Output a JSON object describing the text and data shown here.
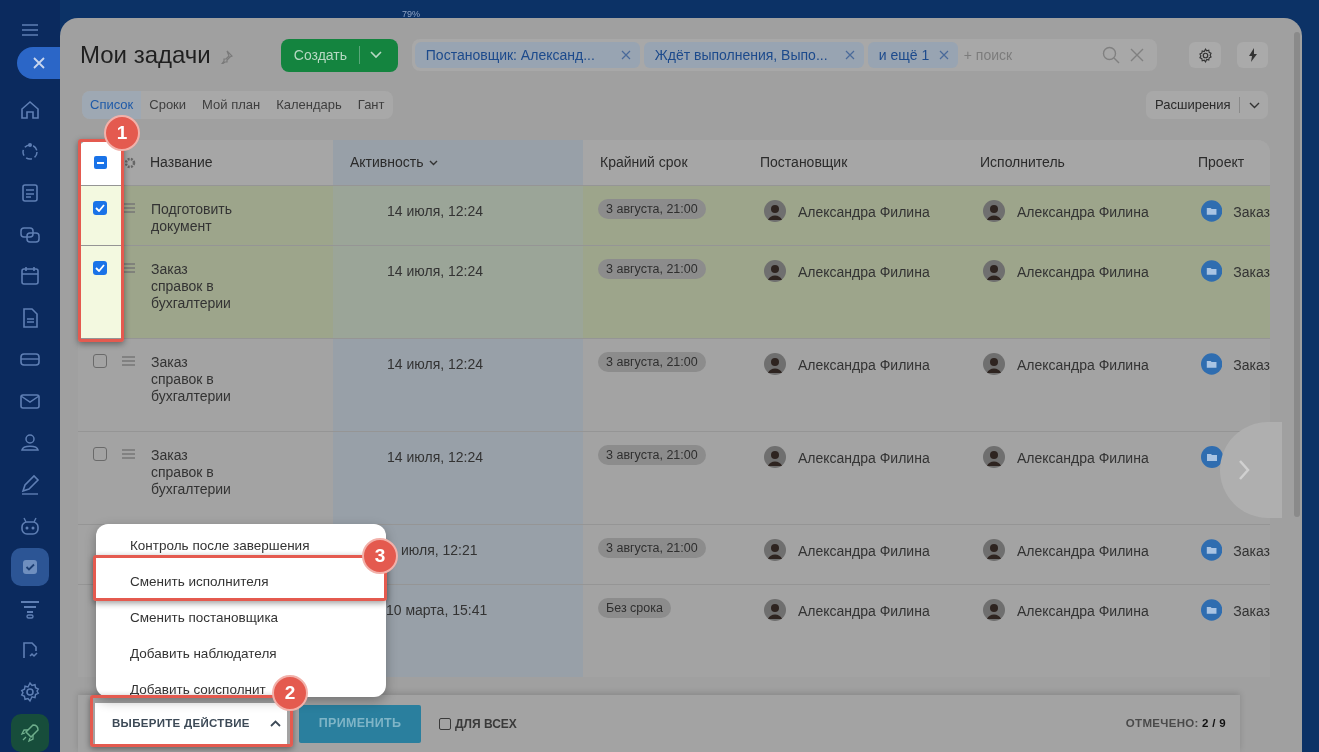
{
  "top_indicator": "79%",
  "sidebar": {
    "items": [
      {
        "kind": "home",
        "selected": false
      },
      {
        "kind": "cycle",
        "selected": false
      },
      {
        "kind": "news",
        "selected": false
      },
      {
        "kind": "chat",
        "selected": false
      },
      {
        "kind": "calendar",
        "selected": false
      },
      {
        "kind": "document",
        "selected": false
      },
      {
        "kind": "card",
        "selected": false
      },
      {
        "kind": "mail",
        "selected": false
      },
      {
        "kind": "people",
        "selected": false
      },
      {
        "kind": "pen",
        "selected": false
      },
      {
        "kind": "robot",
        "selected": false
      },
      {
        "kind": "tasks",
        "selected": true
      },
      {
        "kind": "funnel",
        "selected": false
      },
      {
        "kind": "sign",
        "selected": false
      },
      {
        "kind": "settings",
        "selected": false
      },
      {
        "kind": "rocket",
        "selected": false
      }
    ]
  },
  "header": {
    "title": "Мои задачи",
    "create_button": "Создать",
    "filters": [
      "Постановщик: Александ...",
      "Ждёт выполнения, Выпо...",
      "и ещё 1"
    ],
    "search_placeholder": "+ поиск"
  },
  "tabs": [
    {
      "label": "Список",
      "selected": true
    },
    {
      "label": "Сроки",
      "selected": false
    },
    {
      "label": "Мой план",
      "selected": false
    },
    {
      "label": "Календарь",
      "selected": false
    },
    {
      "label": "Гант",
      "selected": false
    }
  ],
  "extensions_button": "Расширения",
  "table": {
    "header_checkbox": {
      "indeterminate": true
    },
    "columns": [
      "Название",
      "Активность",
      "Крайний срок",
      "Постановщик",
      "Исполнитель",
      "Проект"
    ],
    "rows": [
      {
        "title": "Подготовить документ",
        "checked": true,
        "activity": "14 июля, 12:24",
        "deadline": "3 августа, 21:00",
        "creator": "Александра Филина",
        "assignee": "Александра Филина",
        "project": "Заказ"
      },
      {
        "title": "Заказ справок в бухгалтерии",
        "checked": true,
        "activity": "14 июля, 12:24",
        "deadline": "3 августа, 21:00",
        "creator": "Александра Филина",
        "assignee": "Александра Филина",
        "project": "Заказ"
      },
      {
        "title": "Заказ справок в бухгалтерии",
        "checked": false,
        "activity": "14 июля, 12:24",
        "deadline": "3 августа, 21:00",
        "creator": "Александра Филина",
        "assignee": "Александра Филина",
        "project": "Заказ"
      },
      {
        "title": "Заказ справок в бухгалтерии",
        "checked": false,
        "activity": "14 июля, 12:24",
        "deadline": "3 августа, 21:00",
        "creator": "Александра Филина",
        "assignee": "Александра Филина"
      },
      {
        "activity": "июля, 12:21",
        "deadline": "3 августа, 21:00",
        "creator": "Александра Филина",
        "assignee": "Александра Филина",
        "project": "Заказ"
      },
      {
        "activity": "10 марта, 15:41",
        "deadline": "Без срока",
        "creator": "Александра Филина",
        "assignee": "Александра Филина",
        "project": "Заказ"
      }
    ]
  },
  "action_menu": {
    "items": [
      "Контроль после завершения",
      "Сменить исполнителя",
      "Сменить постановщика",
      "Добавить наблюдателя",
      "Добавить соисполнит"
    ]
  },
  "bottom_bar": {
    "action_select": "ВЫБЕРИТЕ ДЕЙСТВИЕ",
    "apply_button": "ПРИМЕНИТЬ",
    "for_all": {
      "label": "ДЛЯ ВСЕХ",
      "checked": false
    },
    "selected_label": "ОТМЕЧЕНО:",
    "selected_count": "2 / 9"
  },
  "annotations": [
    "1",
    "2",
    "3"
  ]
}
